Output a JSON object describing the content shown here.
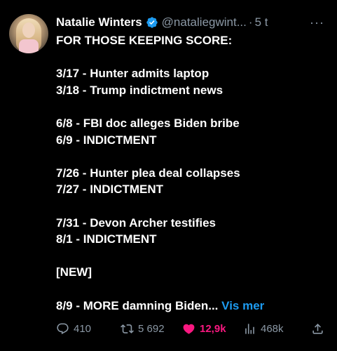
{
  "author": {
    "name": "Natalie Winters",
    "handle": "@nataliegwint...",
    "separator": "·",
    "time": "5 t"
  },
  "more_label": "···",
  "body_lines": [
    "FOR THOSE KEEPING SCORE:",
    "",
    "3/17 - Hunter admits laptop",
    "3/18 - Trump indictment news",
    "",
    "6/8 - FBI doc alleges Biden bribe",
    "6/9 - INDICTMENT",
    "",
    "7/26 - Hunter plea deal collapses",
    "7/27 - INDICTMENT",
    "",
    "7/31 - Devon Archer testifies",
    "8/1 - INDICTMENT",
    "",
    "[NEW]",
    "",
    "8/9 - MORE damning Biden..."
  ],
  "show_more": "Vis mer",
  "actions": {
    "replies": "410",
    "retweets": "5 692",
    "likes": "12,9k",
    "views": "468k"
  },
  "colors": {
    "background": "#000000",
    "text": "#ffffff",
    "muted": "#8b98a5",
    "link": "#1d9bf0",
    "like": "#f91880",
    "verified": "#1d9bf0"
  }
}
